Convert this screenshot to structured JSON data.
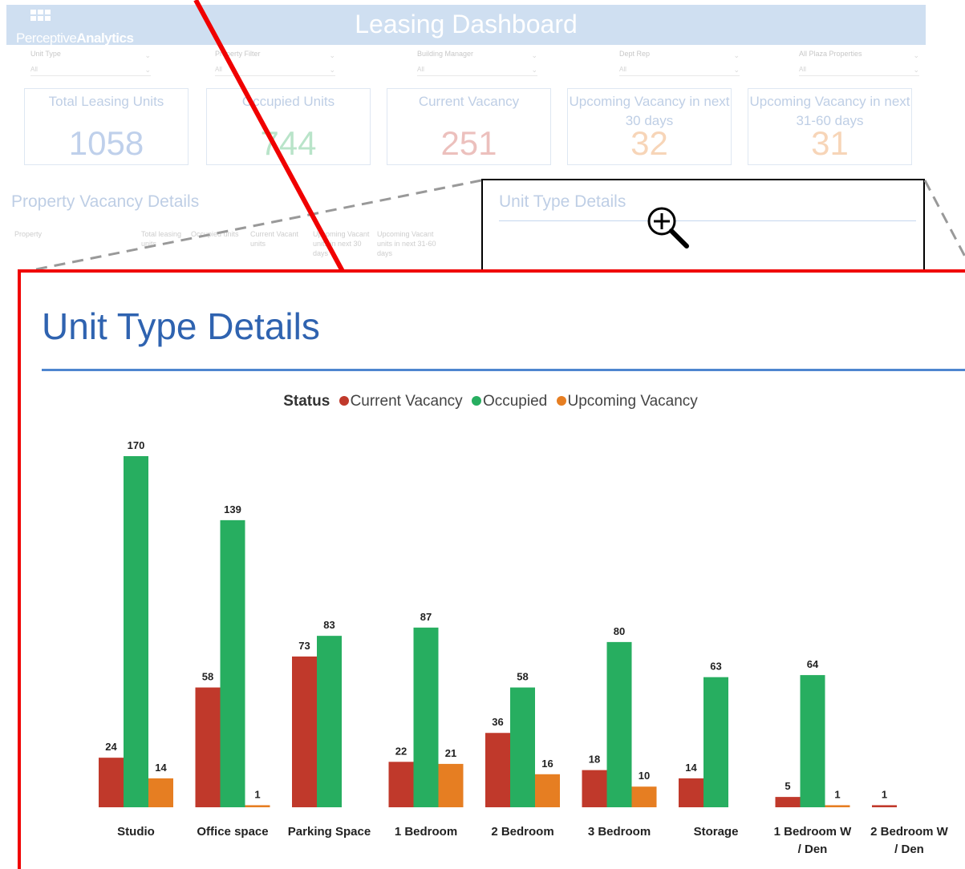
{
  "dashboard": {
    "logo": {
      "brand_a": "Perceptive",
      "brand_b": "Analytics"
    },
    "title": "Leasing Dashboard",
    "filters": [
      {
        "label": "Unit Type",
        "value": "All"
      },
      {
        "label": "Property Filter",
        "value": "All"
      },
      {
        "label": "Building Manager",
        "value": "All"
      },
      {
        "label": "Dept Rep",
        "value": "All"
      },
      {
        "label": "All Plaza Properties",
        "value": "All"
      }
    ],
    "kpis": [
      {
        "label": "Total Leasing Units",
        "value": "1058",
        "color": "#3f74c4"
      },
      {
        "label": "Occupied Units",
        "value": "744",
        "color": "#2eae5e"
      },
      {
        "label": "Current Vacancy",
        "value": "251",
        "color": "#c8423a"
      },
      {
        "label": "Upcoming Vacancy in next 30 days",
        "value": "32",
        "color": "#e8832a"
      },
      {
        "label": "Upcoming Vacancy in next 31-60 days",
        "value": "31",
        "color": "#e8832a"
      }
    ],
    "property_vacancy": {
      "title": "Property Vacancy Details",
      "columns": [
        "Property",
        "Total leasing units",
        "Occupied units",
        "Current Vacant units",
        "Upcoming Vacant units in next 30 days",
        "Upcoming Vacant units in next 31-60 days"
      ]
    },
    "unit_type_title_small": "Unit Type Details"
  },
  "zoom_panel": {
    "title": "Unit Type Details"
  },
  "chart_data": {
    "type": "bar",
    "title": "Unit Type Details",
    "legend_title": "Status",
    "legend_position": "top-center",
    "categories": [
      "Studio",
      "Office space",
      "Parking Space",
      "1 Bedroom",
      "2 Bedroom",
      "3 Bedroom",
      "Storage",
      "1 Bedroom W / Den",
      "2 Bedroom W / Den"
    ],
    "series": [
      {
        "name": "Current Vacancy",
        "color": "#c0392b",
        "values": [
          24,
          58,
          73,
          22,
          36,
          18,
          14,
          5,
          1
        ]
      },
      {
        "name": "Occupied",
        "color": "#27ae60",
        "values": [
          170,
          139,
          83,
          87,
          58,
          80,
          63,
          64,
          null
        ]
      },
      {
        "name": "Upcoming Vacancy",
        "color": "#e67e22",
        "values": [
          14,
          1,
          null,
          21,
          16,
          10,
          null,
          1,
          null
        ]
      }
    ],
    "ylim": [
      0,
      170
    ],
    "grid": false
  }
}
